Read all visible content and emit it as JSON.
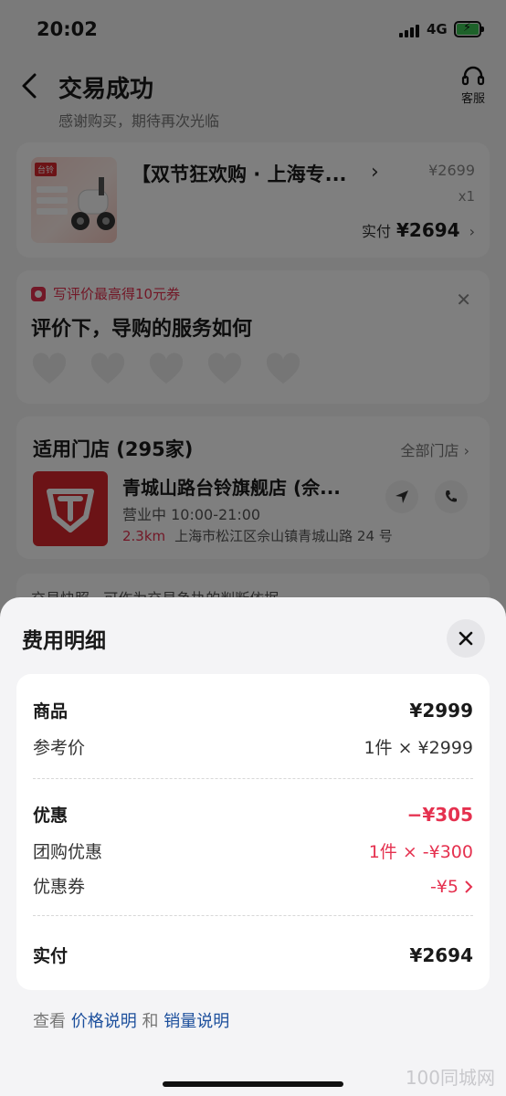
{
  "status_bar": {
    "time": "20:02",
    "network": "4G"
  },
  "header": {
    "title": "交易成功",
    "subtitle": "感谢购买，期待再次光临",
    "service_label": "客服"
  },
  "product": {
    "thumb_tag": "台铃",
    "name": "【双节狂欢购 · 上海专...",
    "price": "¥2699",
    "quantity": "x1",
    "paid_label": "实付",
    "paid_amount": "¥2694"
  },
  "review": {
    "promo": "写评价最高得10元券",
    "question": "评价下，导购的服务如何",
    "hearts": 5
  },
  "store": {
    "heading": "适用门店 (295家)",
    "all_stores": "全部门店",
    "name": "青城山路台铃旗舰店 (佘...",
    "status": "营业中  10:00-21:00",
    "distance": "2.3km",
    "address": "上海市松江区佘山镇青城山路 24 号"
  },
  "snapshot": {
    "text": "交易快照 · 可作为交易争执的判断依据"
  },
  "sheet": {
    "title": "费用明细",
    "goods": {
      "label": "商品",
      "value": "¥2999"
    },
    "reference": {
      "label": "参考价",
      "value": "1件 × ¥2999"
    },
    "discount": {
      "label": "优惠",
      "value": "−¥305"
    },
    "group_discount": {
      "label": "团购优惠",
      "value": "1件 × -¥300"
    },
    "coupon": {
      "label": "优惠券",
      "value": "-¥5"
    },
    "total": {
      "label": "实付",
      "value": "¥2694"
    },
    "footer": {
      "prefix": "查看",
      "price_link": "价格说明",
      "and": "和",
      "sales_link": "销量说明"
    }
  },
  "watermark": "100同城网",
  "colors": {
    "accent_red": "#e5314f",
    "link_blue": "#1c4f9c",
    "brand_red": "#d8262d"
  }
}
